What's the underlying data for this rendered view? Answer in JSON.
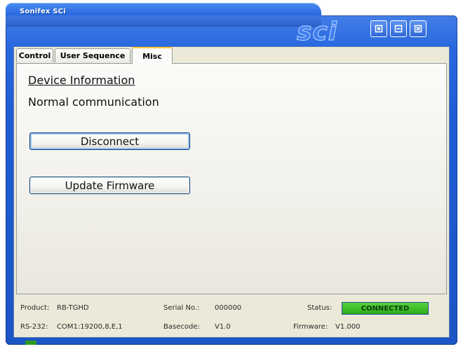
{
  "window": {
    "title": "Sonifex SCi",
    "brand_logo_text": "sci",
    "controls": [
      {
        "name": "restore",
        "icon": "square-icon"
      },
      {
        "name": "minimize",
        "icon": "minus-icon"
      },
      {
        "name": "close",
        "icon": "close-icon"
      }
    ]
  },
  "tabs": [
    {
      "label": "Control",
      "active": false
    },
    {
      "label": "User Sequence",
      "active": false
    },
    {
      "label": "Misc",
      "active": true
    }
  ],
  "misc": {
    "section_title": "Device Information",
    "status_message": "Normal communication",
    "disconnect_label": "Disconnect",
    "update_firmware_label": "Update Firmware"
  },
  "status_bar": {
    "product_label": "Product:",
    "product_value": "RB-TGHD",
    "serial_label": "Serial No.:",
    "serial_value": "000000",
    "status_label": "Status:",
    "status_value": "CONNECTED",
    "rs232_label": "RS-232:",
    "rs232_value": "COM1:19200,8,E,1",
    "basecode_label": "Basecode:",
    "basecode_value": "V1.0",
    "firmware_label": "Firmware:",
    "firmware_value": "V1.000"
  },
  "colors": {
    "frame_blue": "#1f5dd4",
    "connected_green": "#3dbf2a",
    "active_tab_accent": "#ffc83c",
    "client_background": "#ece9d8"
  }
}
